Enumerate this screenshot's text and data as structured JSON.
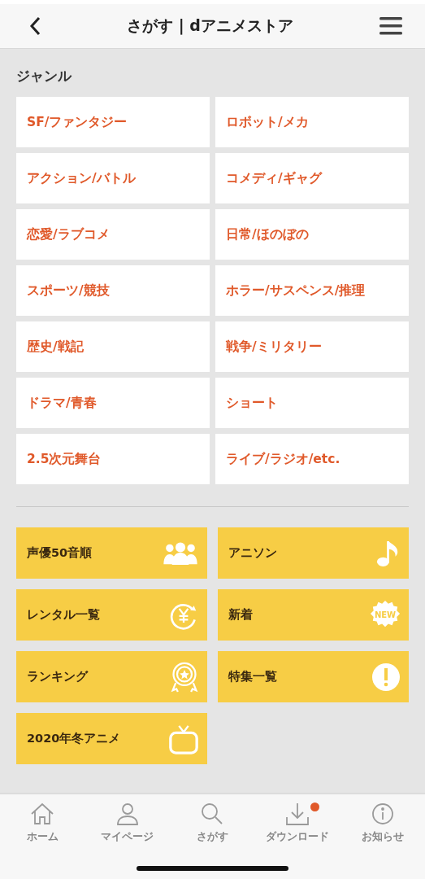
{
  "header": {
    "title": "さがす | dアニメストア"
  },
  "genre_section": {
    "heading": "ジャンル",
    "items": [
      "SF/ファンタジー",
      "ロボット/メカ",
      "アクション/バトル",
      "コメディ/ギャグ",
      "恋愛/ラブコメ",
      "日常/ほのぼの",
      "スポーツ/競技",
      "ホラー/サスペンス/推理",
      "歴史/戦記",
      "戦争/ミリタリー",
      "ドラマ/青春",
      "ショート",
      "2.5次元舞台",
      "ライブ/ラジオ/etc."
    ]
  },
  "quick_links": [
    {
      "label": "声優50音順",
      "kind": "people"
    },
    {
      "label": "アニソン",
      "kind": "note"
    },
    {
      "label": "レンタル一覧",
      "kind": "yen"
    },
    {
      "label": "新着",
      "kind": "new",
      "icon_text": "NEW"
    },
    {
      "label": "ランキング",
      "kind": "medal"
    },
    {
      "label": "特集一覧",
      "kind": "exclaim"
    },
    {
      "label": "2020年冬アニメ",
      "kind": "tv"
    }
  ],
  "tab_bar": [
    {
      "label": "ホーム",
      "kind": "home",
      "dot": false
    },
    {
      "label": "マイページ",
      "kind": "person",
      "dot": false
    },
    {
      "label": "さがす",
      "kind": "search",
      "dot": false
    },
    {
      "label": "ダウンロード",
      "kind": "download",
      "dot": true
    },
    {
      "label": "お知らせ",
      "kind": "info",
      "dot": false
    }
  ]
}
